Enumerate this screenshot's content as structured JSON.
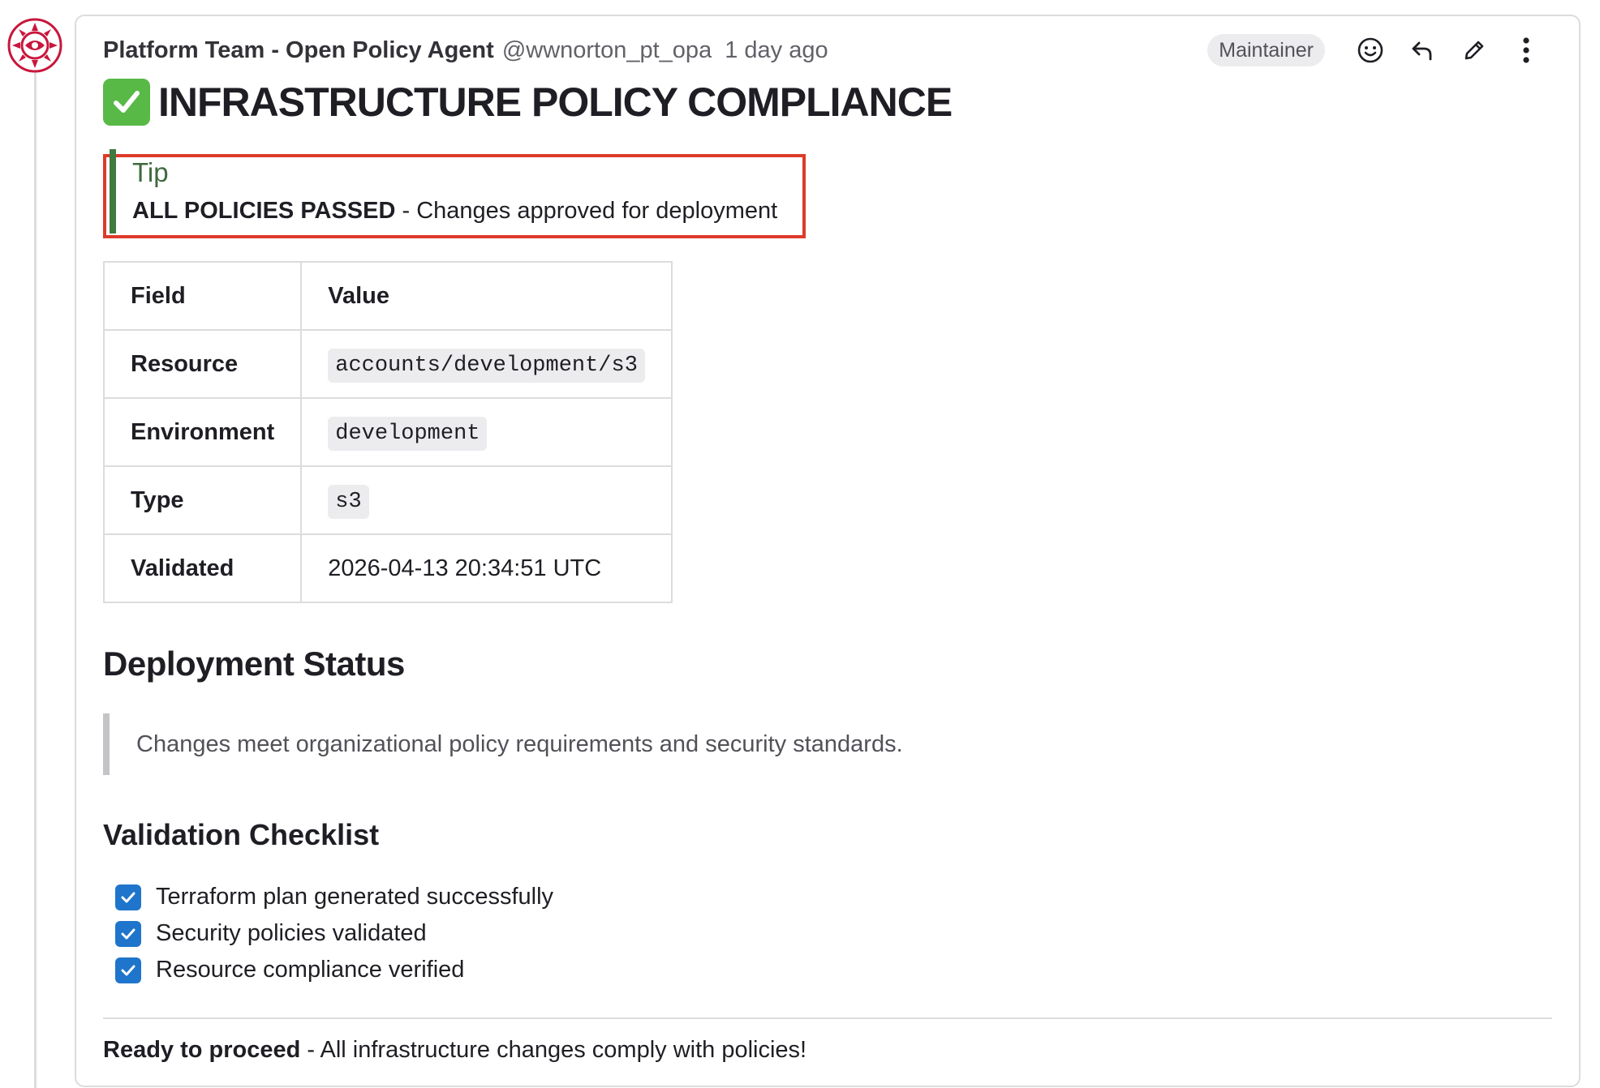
{
  "note": {
    "author_name": "Platform Team - Open Policy Agent",
    "author_handle": "@wwnorton_pt_opa",
    "time": "1 day ago",
    "role_badge": "Maintainer",
    "actions": [
      {
        "icon": "emoji-reaction-icon"
      },
      {
        "icon": "reply-icon"
      },
      {
        "icon": "pencil-icon"
      },
      {
        "icon": "kebab-menu-icon"
      }
    ]
  },
  "content": {
    "title": "INFRASTRUCTURE POLICY COMPLIANCE",
    "tip": {
      "label": "Tip",
      "bold": "ALL POLICIES PASSED",
      "text": " - Changes approved for deployment"
    },
    "table": {
      "headers": [
        "Field",
        "Value"
      ],
      "rows": [
        {
          "field": "Resource",
          "value": "accounts/development/s3",
          "code": true
        },
        {
          "field": "Environment",
          "value": "development",
          "code": true
        },
        {
          "field": "Type",
          "value": "s3",
          "code": true
        },
        {
          "field": "Validated",
          "value": "2026-04-13 20:34:51 UTC",
          "code": false
        }
      ]
    },
    "deployment_heading": "Deployment Status",
    "deployment_quote": "Changes meet organizational policy requirements and security standards.",
    "checklist_heading": "Validation Checklist",
    "checklist": [
      {
        "label": "Terraform plan generated successfully",
        "checked": true
      },
      {
        "label": "Security policies validated",
        "checked": true
      },
      {
        "label": "Resource compliance verified",
        "checked": true
      }
    ],
    "footer_bold": "Ready to proceed",
    "footer_text": " - All infrastructure changes comply with policies!"
  },
  "colors": {
    "tip_accent": "#3f7a3f",
    "highlight_border": "#dd3b2a",
    "checkbox": "#1f75cb",
    "check_emoji": "#58b947"
  }
}
